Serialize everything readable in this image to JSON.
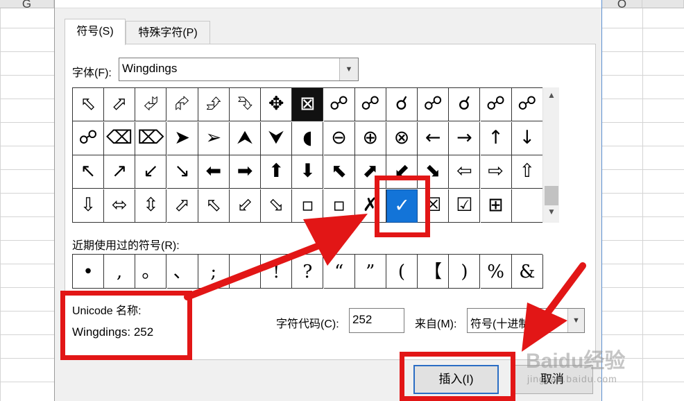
{
  "sheet": {
    "columns": [
      "G",
      "O"
    ]
  },
  "dialog": {
    "tabs": [
      "符号(S)",
      "特殊字符(P)"
    ],
    "font_label": "字体(F):",
    "font_value": "Wingdings",
    "symbol_rows": [
      [
        "⬁",
        "⬀",
        "⮰",
        "⮳",
        "⮵",
        "⮷",
        "✥",
        "⊠",
        "☍",
        "☍",
        "☌",
        "☍",
        "☌",
        "☍",
        "☍"
      ],
      [
        "☍",
        "⌫",
        "⌦",
        "➤",
        "➢",
        "⮝",
        "⮟",
        "◖",
        "⊖",
        "⊕",
        "⊗",
        "←",
        "→",
        "↑",
        "↓"
      ],
      [
        "↖",
        "↗",
        "↙",
        "↘",
        "⬅",
        "➡",
        "⬆",
        "⬇",
        "⬉",
        "⬈",
        "⬋",
        "⬊",
        "⇦",
        "⇨",
        "⇧"
      ],
      [
        "⇩",
        "⬄",
        "⇳",
        "⬀",
        "⬁",
        "⬃",
        "⬂",
        "▫",
        "▫",
        "✗",
        "✓",
        "☒",
        "☑",
        "⊞",
        ""
      ]
    ],
    "dark_cells": [
      "0-7"
    ],
    "selected_cell": "3-10",
    "recent_label": "近期使用过的符号(R):",
    "recent_symbols": [
      "•",
      ",",
      "。",
      "、",
      ";",
      ".",
      "!",
      "?",
      "“",
      "”",
      "(",
      "【",
      ")",
      "%",
      "&"
    ],
    "unicode_name_label": "Unicode 名称:",
    "unicode_name_value": "Wingdings: 252",
    "char_code_label": "字符代码(C):",
    "char_code_value": "252",
    "from_label": "来自(M):",
    "from_value": "符号(十进制)",
    "insert_label": "插入(I)",
    "cancel_label": "取消"
  },
  "annotation": {
    "color": "#e21616"
  },
  "watermark": {
    "brand": "Baidu经验",
    "url": "jingyan.baidu.com"
  }
}
